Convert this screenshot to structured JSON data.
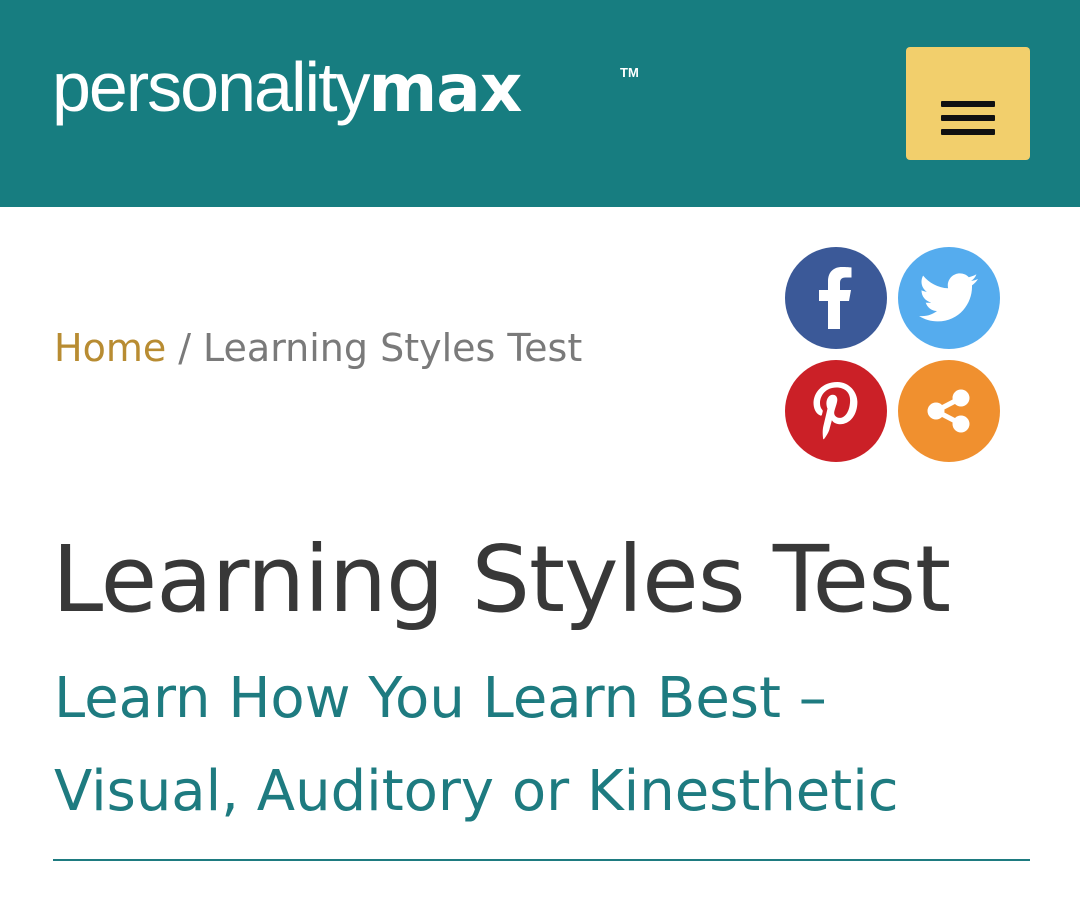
{
  "header": {
    "logo": {
      "light": "personality",
      "bold": "max",
      "tm": "TM"
    },
    "menu_icon": "hamburger-menu-icon",
    "background_color": "#177d80",
    "menu_button_color": "#f2cf6c"
  },
  "breadcrumb": {
    "home": "Home",
    "separator": "/",
    "current": "Learning Styles Test"
  },
  "share": {
    "facebook": {
      "icon": "facebook-icon",
      "color": "#3b5998"
    },
    "twitter": {
      "icon": "twitter-icon",
      "color": "#55acee"
    },
    "pinterest": {
      "icon": "pinterest-icon",
      "color": "#cb2027"
    },
    "share": {
      "icon": "share-icon",
      "color": "#f0902f"
    }
  },
  "main": {
    "title": "Learning Styles Test",
    "subtitle": "Learn How You Learn Best – Visual, Auditory or Kinesthetic"
  },
  "colors": {
    "accent": "#1e7b80",
    "breadcrumb_link": "#b88c32",
    "title_text": "#383838"
  }
}
